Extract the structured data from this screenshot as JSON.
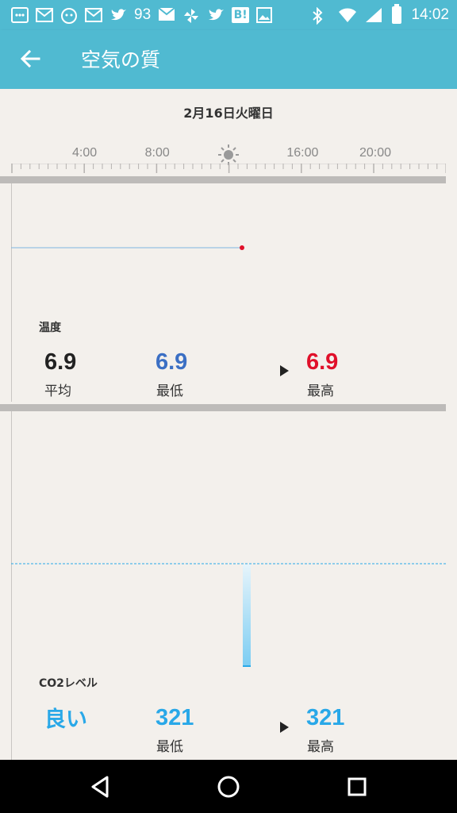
{
  "status_bar": {
    "notification_count": "93",
    "hatena_label": "B!",
    "time": "14:02",
    "icons_left": [
      "chat-bubble-icon",
      "gmail-icon",
      "anime-avatar-icon",
      "gmail-icon",
      "twitter-icon",
      "mail-icon",
      "pinwheel-icon",
      "twitter-icon",
      "hatena-bookmark-icon",
      "image-icon"
    ],
    "icons_right": [
      "bluetooth-icon",
      "wifi-icon",
      "signal-icon",
      "battery-icon"
    ]
  },
  "app_bar": {
    "title": "空気の質",
    "back_icon": "arrow-left-icon"
  },
  "date": "2月16日火曜日",
  "time_axis": {
    "ticks": [
      "4:00",
      "8:00",
      "16:00",
      "20:00"
    ],
    "hours": [
      4,
      8,
      16,
      20
    ],
    "noon_icon": "sun-icon"
  },
  "temperature": {
    "label": "温度",
    "average": {
      "value": "6.9",
      "caption": "平均"
    },
    "min": {
      "value": "6.9",
      "caption": "最低"
    },
    "max": {
      "value": "6.9",
      "caption": "最高"
    },
    "colors": {
      "average": "#222222",
      "min": "#3b6fc4",
      "max": "#e0102a",
      "line": "#7fb6e0"
    }
  },
  "co2": {
    "label": "CO2レベル",
    "status": {
      "value": "良い"
    },
    "min": {
      "value": "321",
      "caption": "最低"
    },
    "max": {
      "value": "321",
      "caption": "最高"
    },
    "colors": {
      "accent": "#29a8e8",
      "threshold_line": "#29a8e8"
    }
  },
  "nav_bar": {
    "buttons": [
      "back-triangle-icon",
      "home-circle-icon",
      "recents-square-icon"
    ]
  }
}
